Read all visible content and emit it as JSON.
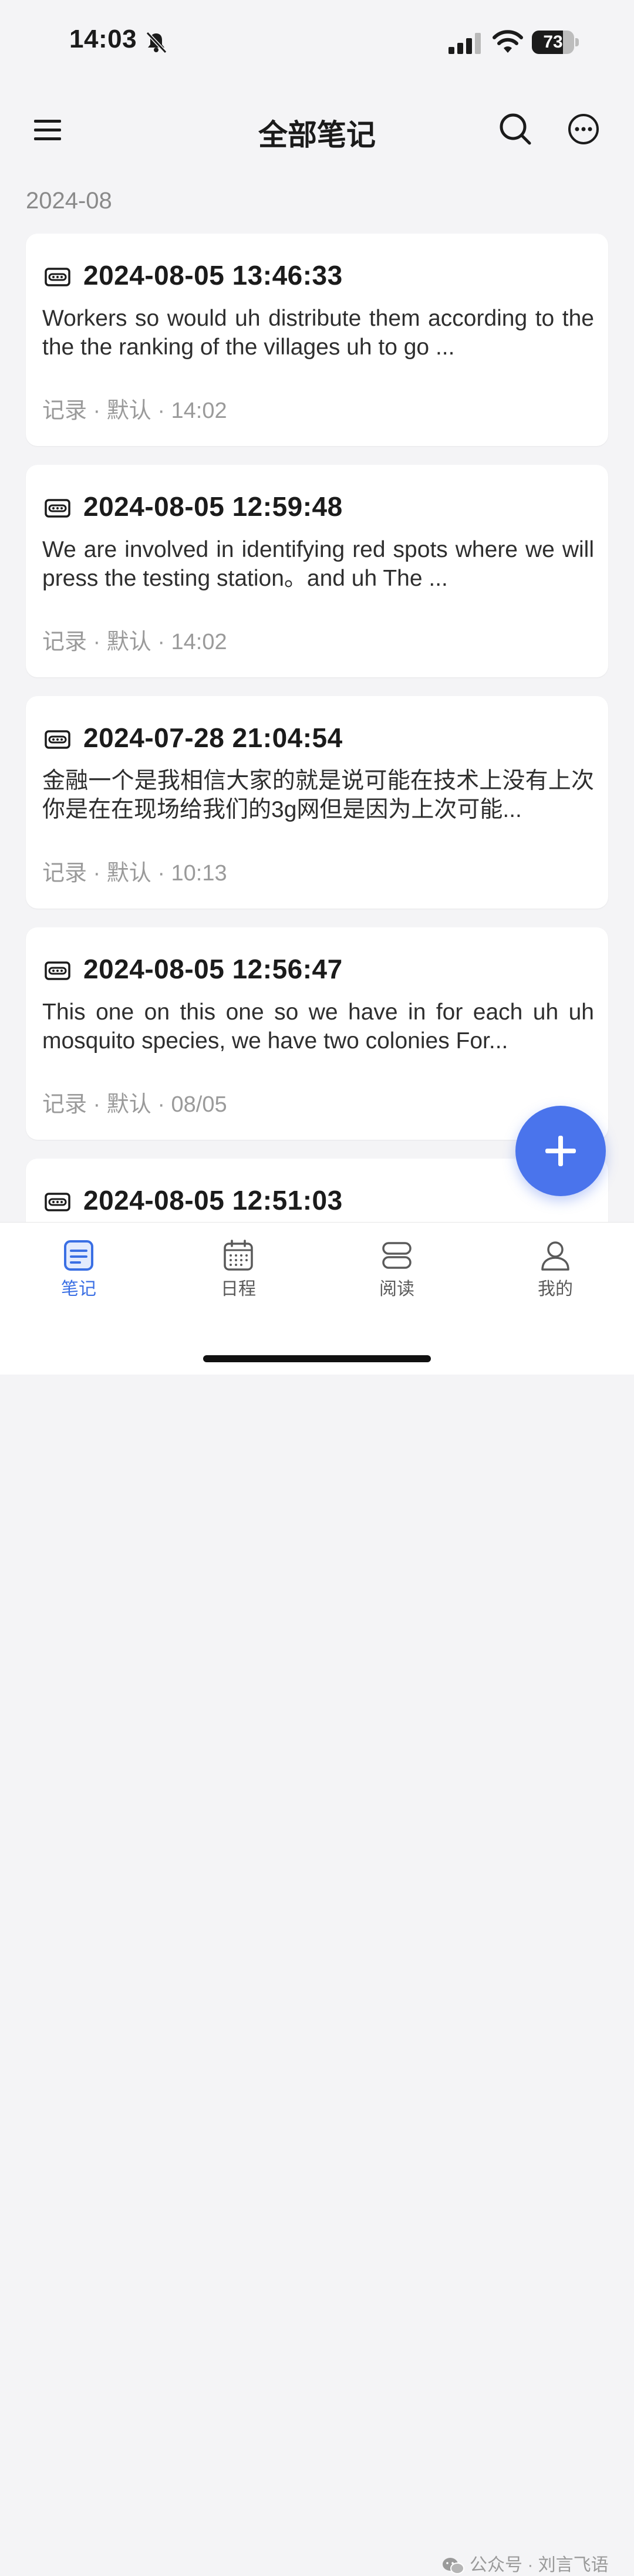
{
  "status_bar": {
    "time": "14:03",
    "battery": "73",
    "battery_level": 0.73
  },
  "header": {
    "title": "全部笔记"
  },
  "month_label": "2024-08",
  "notes": [
    {
      "title": "2024-08-05 13:46:33",
      "preview": " Workers so would uh distribute them according to the the the ranking of the villages uh to go ...",
      "meta": "记录 · 默认 · 14:02"
    },
    {
      "title": "2024-08-05 12:59:48",
      "preview": " We are involved in identifying red spots where we will press the testing station。and uh The ...",
      "meta": "记录 · 默认 · 14:02"
    },
    {
      "title": "2024-07-28 21:04:54",
      "preview": "金融一个是我相信大家的就是说可能在技术上没有上次你是在在现场给我们的3g网但是因为上次可能...",
      "meta": "记录 · 默认 · 10:13"
    },
    {
      "title": "2024-08-05 12:56:47",
      "preview": " This one on this one so we have in for each uh uh mosquito species, we have two colonies For...",
      "meta": "记录 · 默认 · 08/05"
    },
    {
      "title": "2024-08-05 12:51:03",
      "preview": "",
      "meta": ""
    }
  ],
  "tabs": [
    {
      "label": "笔记",
      "icon": "notes-icon",
      "active": true
    },
    {
      "label": "日程",
      "icon": "calendar-icon",
      "active": false
    },
    {
      "label": "阅读",
      "icon": "reading-icon",
      "active": false
    },
    {
      "label": "我的",
      "icon": "profile-icon",
      "active": false
    }
  ],
  "watermark": "公众号 · 刘言飞语",
  "colors": {
    "accent": "#3a6fe4",
    "fab": "#4a74ec",
    "background": "#f4f4f6"
  }
}
